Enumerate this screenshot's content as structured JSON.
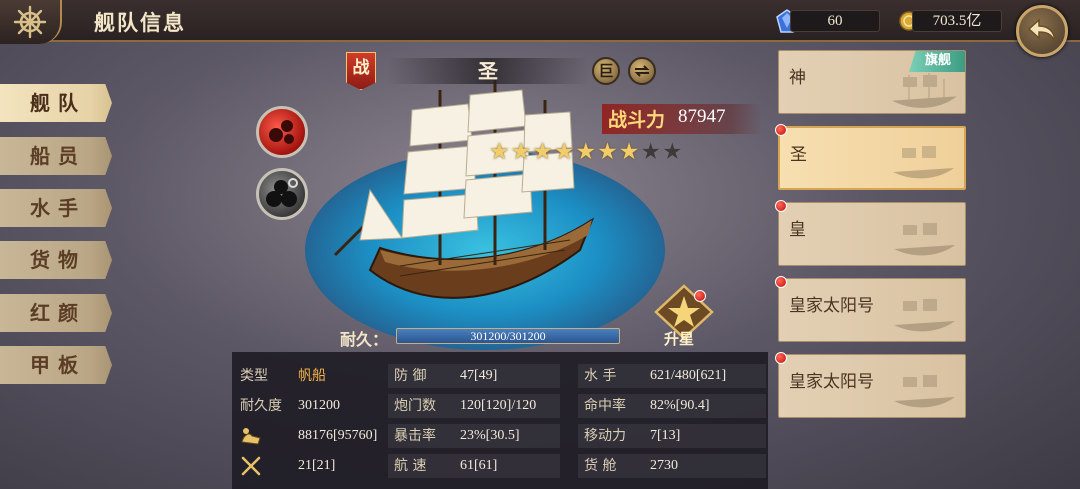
{
  "header": {
    "title": "舰队信息",
    "gems": "60",
    "gold": "703.5亿",
    "gem_icon": "blue-crystal-icon",
    "gold_icon": "gold-coin-icon"
  },
  "menu": {
    "items": [
      {
        "label": "舰队"
      },
      {
        "label": "船员"
      },
      {
        "label": "水手"
      },
      {
        "label": "货物"
      },
      {
        "label": "红颜"
      },
      {
        "label": "甲板"
      }
    ],
    "active_index": 0
  },
  "ship": {
    "battle_badge": "战",
    "name": "圣",
    "size_badge": "巨",
    "power_label": "战斗力",
    "power_value": "87947",
    "stars_lit": 7,
    "stars_total": 9,
    "durability_label": "耐久：",
    "durability_value": "301200/301200",
    "durability_fraction": 1.0,
    "upgrade_star_label": "升星"
  },
  "stats": {
    "type_label": "类型",
    "type_value": "帆船",
    "durability_label": "耐久度",
    "durability_value": "301200",
    "cargo_value": "88176[95760]",
    "attack_value": "21[21]",
    "defense_label": "防 御",
    "defense_value": "47[49]",
    "cannons_label": "炮门数",
    "cannons_value": "120[120]/120",
    "crit_label": "暴击率",
    "crit_value": "23%[30.5]",
    "speed_label": "航 速",
    "speed_value": "61[61]",
    "sailors_label": "水 手",
    "sailors_value": "621/480[621]",
    "hit_label": "命中率",
    "hit_value": "82%[90.4]",
    "move_label": "移动力",
    "move_value": "7[13]",
    "hold_label": "货 舱",
    "hold_value": "2730"
  },
  "fleet": {
    "flagship_tag": "旗舰",
    "ships": [
      {
        "name": "神"
      },
      {
        "name": "圣"
      },
      {
        "name": "皇"
      },
      {
        "name": "皇家太阳号"
      },
      {
        "name": "皇家太阳号"
      }
    ],
    "selected_index": 1
  },
  "colors": {
    "accent_gold": "#f0cc6a",
    "power_red": "#961914",
    "durability_blue": "#2a5591",
    "notification_red": "#c00e0a"
  }
}
